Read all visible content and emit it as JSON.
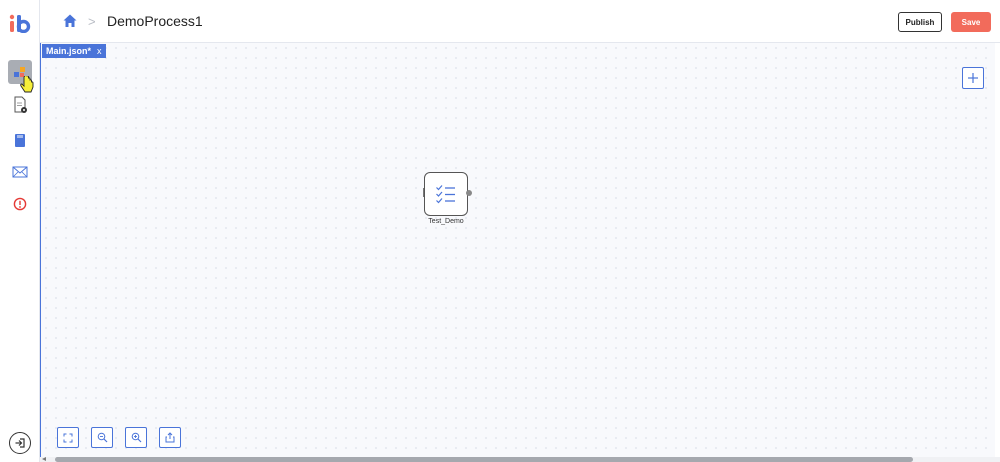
{
  "header": {
    "title": "DemoProcess1",
    "breadcrumb_separator": ">",
    "publish_label": "Publish",
    "save_label": "Save"
  },
  "editor": {
    "tab": {
      "label": "Main.json*",
      "close": "x"
    },
    "node": {
      "label": "Test_Demo",
      "icon": "checklist-icon"
    }
  },
  "sidebar": {
    "items": [
      {
        "icon": "process-flow-icon",
        "active": true
      },
      {
        "icon": "document-settings-icon",
        "active": false
      },
      {
        "icon": "storage-card-icon",
        "active": false
      },
      {
        "icon": "mail-icon",
        "active": false
      },
      {
        "icon": "alert-icon",
        "active": false
      }
    ],
    "exit_icon": "exit-icon"
  },
  "toolbar": {
    "zoom": [
      "fit-screen-icon",
      "zoom-out-icon",
      "zoom-in-icon",
      "export-icon"
    ],
    "add": "plus-icon"
  },
  "colors": {
    "accent": "#4a74d9",
    "save": "#f26b5b",
    "canvas": "#f8f9fc",
    "alert": "#e53935"
  }
}
